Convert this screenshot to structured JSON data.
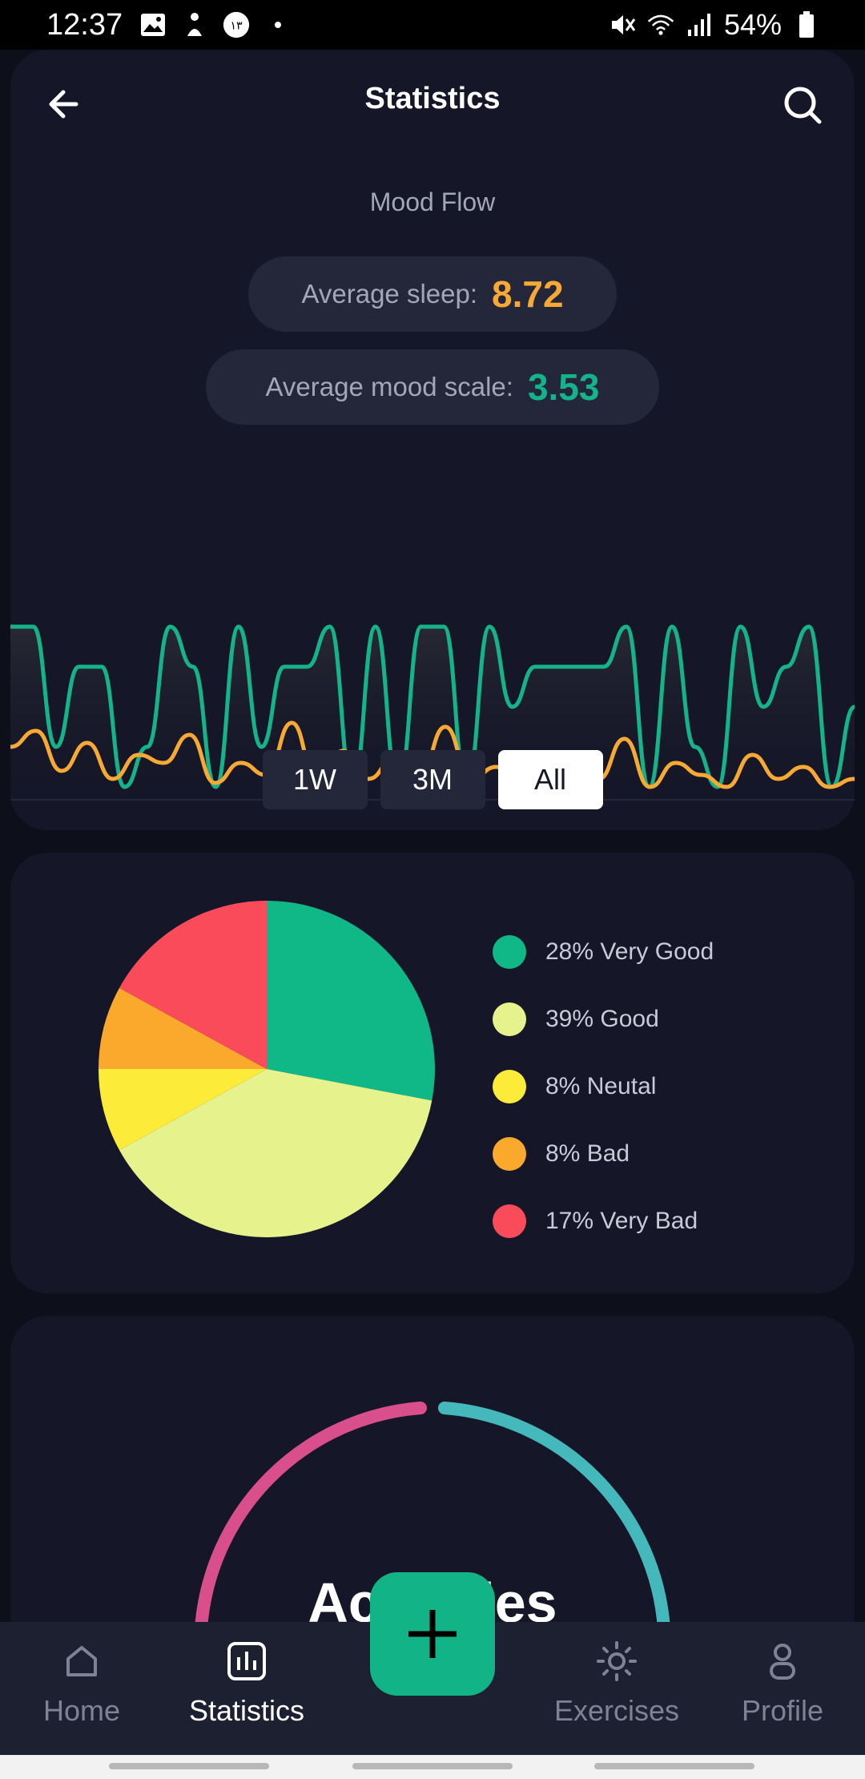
{
  "status_bar": {
    "time": "12:37",
    "battery": "54%",
    "badge_text": "١٣"
  },
  "header": {
    "title": "Statistics"
  },
  "mood_flow": {
    "label": "Mood Flow",
    "avg_sleep_label": "Average sleep:",
    "avg_sleep_value": "8.72",
    "avg_mood_label": "Average mood scale:",
    "avg_mood_value": "3.53"
  },
  "chart_data": [
    {
      "type": "line",
      "series": [
        {
          "color": "#14b38a",
          "values": [
            5,
            5,
            2,
            4,
            4,
            1,
            2,
            5,
            4,
            1,
            5,
            2,
            4,
            4,
            5,
            1,
            5,
            1,
            5,
            5,
            1,
            5,
            3,
            4,
            4,
            4,
            4,
            5,
            1,
            5,
            2,
            1,
            5,
            3,
            4,
            5,
            1,
            3
          ]
        },
        {
          "color": "#f7a934",
          "values": [
            2,
            2.4,
            1.4,
            2.1,
            1.2,
            1.8,
            1.6,
            2.3,
            1.1,
            1.6,
            1.3,
            2.6,
            1.1,
            1.9,
            1.2,
            1.7,
            1.3,
            2.5,
            1.2,
            1.5,
            1,
            1.8,
            1,
            1.2,
            2.2,
            1,
            1.6,
            1.3,
            1,
            1.8,
            1.2,
            1.5,
            1,
            1.2
          ]
        }
      ],
      "range_options": [
        "1W",
        "3M",
        "All"
      ],
      "selected_range": "All"
    },
    {
      "type": "pie",
      "slices": [
        {
          "label": "28% Very Good",
          "value": 28,
          "color": "#0fb886"
        },
        {
          "label": "39% Good",
          "value": 39,
          "color": "#e6f28c"
        },
        {
          "label": "8% Neutal",
          "value": 8,
          "color": "#fdeb3a"
        },
        {
          "label": "8% Bad",
          "value": 8,
          "color": "#fba92c"
        },
        {
          "label": "17% Very Bad",
          "value": 17,
          "color": "#fa4b5a"
        }
      ]
    }
  ],
  "activities": {
    "title": "Activities",
    "arc_colors": [
      "#d84f8c",
      "#45b8bb"
    ]
  },
  "bottom_nav": {
    "items": [
      {
        "label": "Home",
        "icon": "home-icon"
      },
      {
        "label": "Statistics",
        "icon": "bar-chart-icon"
      },
      {
        "label": "Exercises",
        "icon": "sun-icon"
      },
      {
        "label": "Profile",
        "icon": "person-icon"
      }
    ],
    "fab_icon": "plus-icon"
  }
}
